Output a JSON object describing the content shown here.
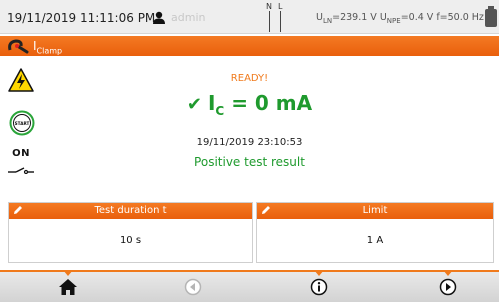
{
  "status_bar": {
    "datetime": "19/11/2019 11:11:06 PM",
    "user": "admin",
    "phase_n": "N",
    "phase_l": "L",
    "measurements": {
      "uln_label": "U",
      "uln_sub": "LN",
      "uln_value": "=239.1 V",
      "unpe_label": "U",
      "unpe_sub": "NPE",
      "unpe_value": "=0.4 V",
      "freq": "f=50.0 Hz"
    },
    "icons": [
      "user-icon",
      "phase-indicator-icon",
      "battery-icon"
    ]
  },
  "title_bar": {
    "title_main": "I",
    "title_sub": "Clamp",
    "icon": "clamp-probe-icon"
  },
  "left_icons": {
    "warning": "high-voltage-warning-icon",
    "start": "START",
    "on": "ON"
  },
  "result": {
    "state": "READY!",
    "symbol": "I",
    "symbol_sub": "C",
    "value": " = 0 mA",
    "timestamp": "19/11/2019 23:10:53",
    "verdict": "Positive test result"
  },
  "panels": [
    {
      "label": "Test duration t",
      "value": "10 s"
    },
    {
      "label": "Limit",
      "value": "1 A"
    }
  ],
  "nav": [
    "home-icon",
    "back-icon",
    "info-icon",
    "forward-icon"
  ],
  "colors": {
    "accent": "#f07a1c",
    "ok": "#1f9a2e",
    "statusbar_bg": "#eeeeee"
  }
}
